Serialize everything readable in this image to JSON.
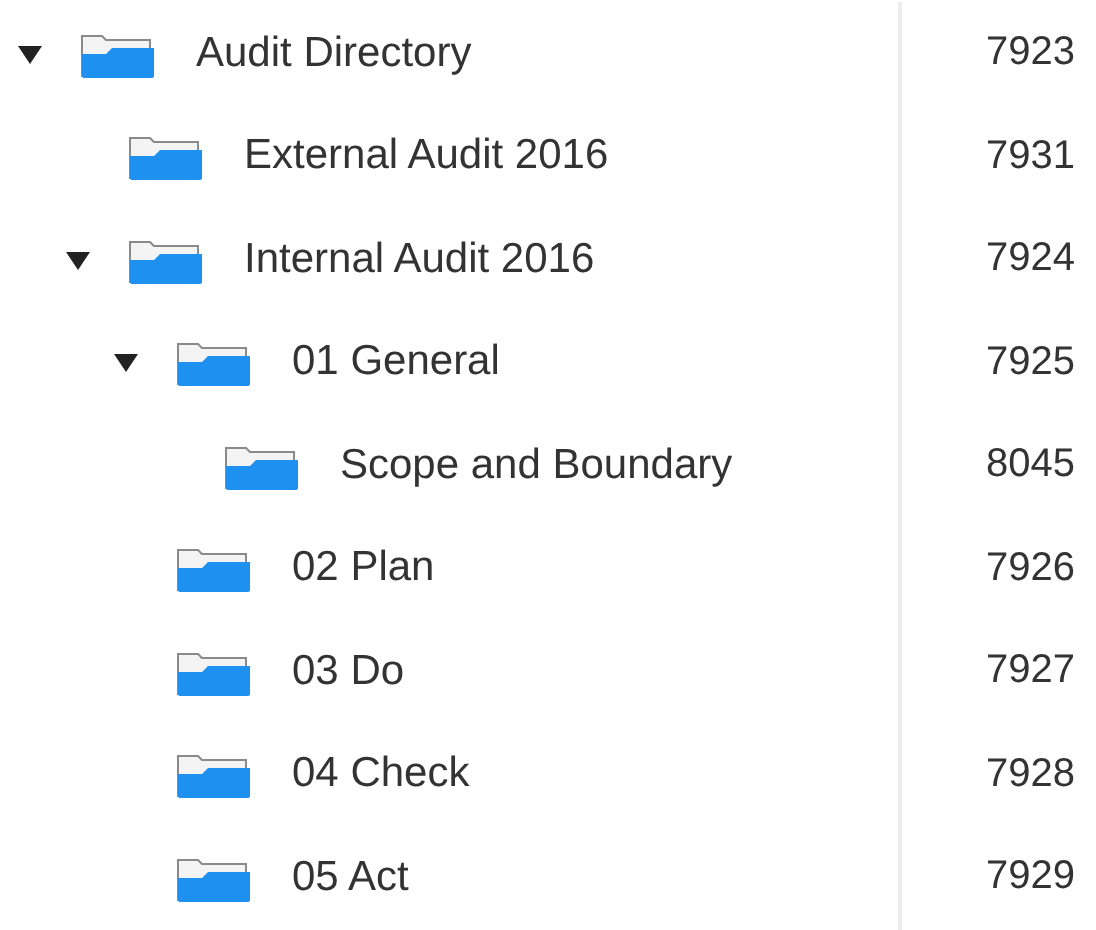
{
  "tree": [
    {
      "name": "Audit Directory",
      "id": "7923",
      "expanded": true,
      "children": [
        {
          "name": "External Audit 2016",
          "id": "7931"
        },
        {
          "name": "Internal Audit 2016",
          "id": "7924",
          "expanded": true,
          "children": [
            {
              "name": "01 General",
              "id": "7925",
              "expanded": true,
              "children": [
                {
                  "name": "Scope and Boundary",
                  "id": "8045"
                }
              ]
            },
            {
              "name": "02 Plan",
              "id": "7926"
            },
            {
              "name": "03 Do",
              "id": "7927"
            },
            {
              "name": "04 Check",
              "id": "7928"
            },
            {
              "name": "05 Act",
              "id": "7929"
            }
          ]
        }
      ]
    }
  ]
}
